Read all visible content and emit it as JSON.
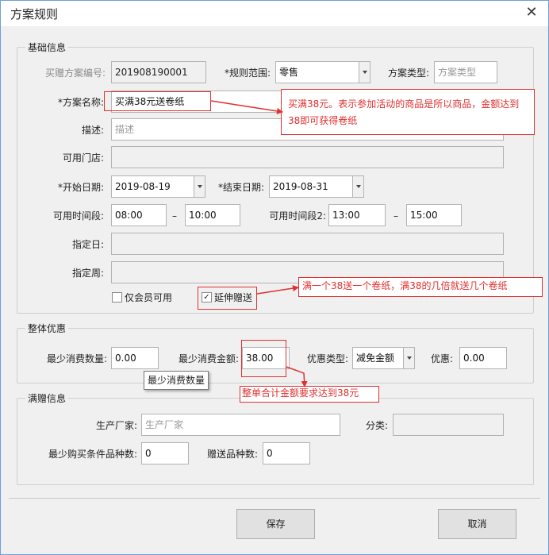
{
  "window": {
    "title": "方案规则"
  },
  "basic": {
    "legend": "基础信息",
    "code_label": "买赠方案编号:",
    "code_value": "201908190001",
    "scope_label": "*规则范围:",
    "scope_value": "零售",
    "type_label": "方案类型:",
    "type_placeholder": "方案类型",
    "name_label": "*方案名称:",
    "name_value": "买满38元送卷纸",
    "desc_label": "描述:",
    "desc_placeholder": "描述",
    "stores_label": "可用门店:",
    "start_label": "*开始日期:",
    "start_value": "2019-08-19",
    "end_label": "*结束日期:",
    "end_value": "2019-08-31",
    "time1_label": "可用时间段:",
    "time1_from": "08:00",
    "time1_to": "10:00",
    "time2_label": "可用时间段2:",
    "time2_from": "13:00",
    "time2_to": "15:00",
    "dash": "–",
    "day_label": "指定日:",
    "week_label": "指定周:",
    "member_only_label": "仅会员可用",
    "member_only_checked": false,
    "extend_label": "延伸赠送",
    "extend_checked": true,
    "check_mark": "✓"
  },
  "overall": {
    "legend": "整体优惠",
    "min_qty_label": "最少消费数量:",
    "min_qty_value": "0.00",
    "min_amount_label": "最少消费金额:",
    "min_amount_value": "38.00",
    "discount_type_label": "优惠类型:",
    "discount_type_value": "减免金额",
    "discount_label": "优惠:",
    "discount_value": "0.00",
    "tooltip": "最少消费数量"
  },
  "gift": {
    "legend": "满赠信息",
    "maker_label": "生产厂家:",
    "maker_placeholder": "生产厂家",
    "category_label": "分类:",
    "min_kinds_label": "最少购买条件品种数:",
    "min_kinds_value": "0",
    "gift_kinds_label": "赠送品种数:",
    "gift_kinds_value": "0"
  },
  "annotations": {
    "note1": "买满38元。表示参加活动的商品是所以商品，金额达到38即可获得卷纸",
    "note2": "满一个38送一个卷纸，满38的几倍就送几个卷纸",
    "note3": "整单合计金额要求达到38元",
    "color": "#e03030"
  },
  "buttons": {
    "save": "保存",
    "cancel": "取消"
  },
  "icons": {
    "close": "close-icon",
    "dropdown": "chevron-down-icon",
    "check": "checkbox-icon"
  }
}
